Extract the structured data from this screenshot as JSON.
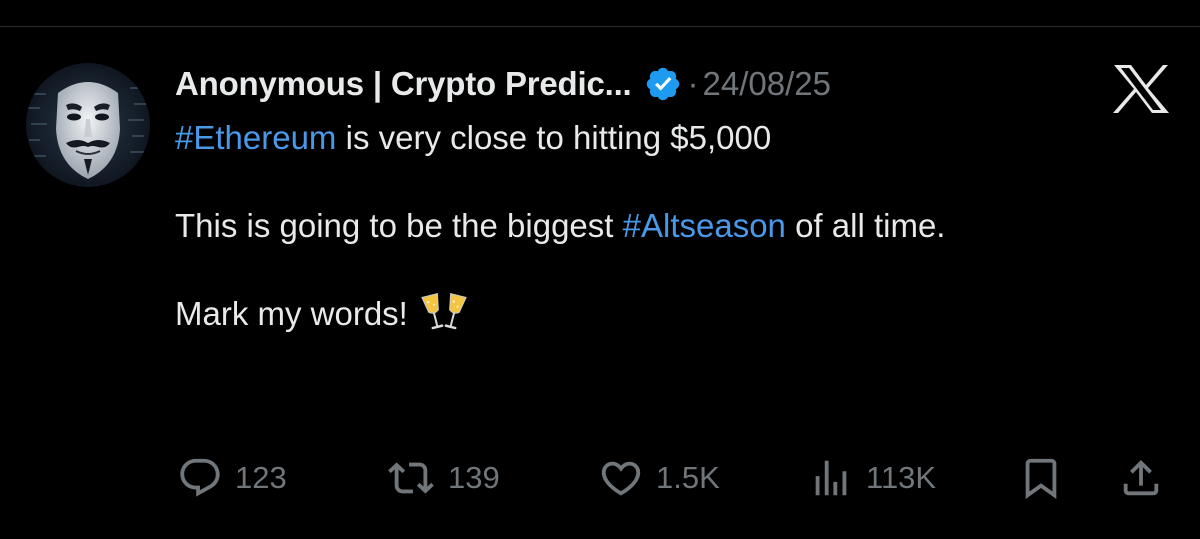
{
  "tweet": {
    "display_name": "Anonymous | Crypto Predic...",
    "separator": "·",
    "date": "24/08/25",
    "verified": true,
    "body": {
      "line1_hashtag": "#Ethereum",
      "line1_text": " is very close to hitting $5,000",
      "line2_text_before": "This is going to be the biggest ",
      "line2_hashtag": "#Altseason",
      "line2_text_after": " of all time.",
      "line3_text": "Mark my words!",
      "line3_emoji": "clinking-glasses"
    }
  },
  "actions": {
    "replies": "123",
    "reposts": "139",
    "likes": "1.5K",
    "views": "113K"
  },
  "icons": {
    "avatar": "anonymous-mask-avatar",
    "verified": "verified-badge-icon",
    "platform_logo": "x-logo",
    "reply": "reply-icon",
    "repost": "repost-icon",
    "like": "heart-icon",
    "views": "views-icon",
    "bookmark": "bookmark-icon",
    "share": "share-icon"
  },
  "colors": {
    "background": "#000000",
    "text": "#e7e9ea",
    "secondary": "#71767b",
    "link": "#4a99e9",
    "verified": "#1d9bf0"
  }
}
